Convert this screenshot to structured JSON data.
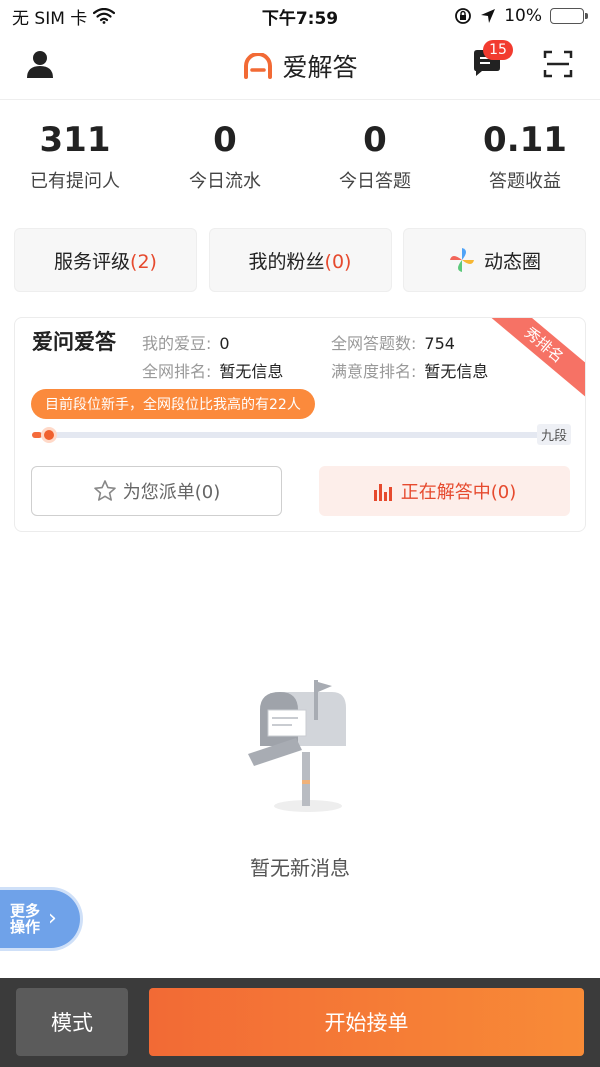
{
  "status_bar": {
    "carrier": "无 SIM 卡",
    "time": "下午7:59",
    "battery_percent": "10%",
    "battery_level": 0.1,
    "battery_color": "#e23b2b"
  },
  "header": {
    "title": "爱解答",
    "message_badge": "15",
    "accent": "#f26a35"
  },
  "stats": [
    {
      "value": "311",
      "label": "已有提问人"
    },
    {
      "value": "0",
      "label": "今日流水"
    },
    {
      "value": "0",
      "label": "今日答题"
    },
    {
      "value": "0.11",
      "label": "答题收益"
    }
  ],
  "quick_buttons": {
    "service_rating_label": "服务评级",
    "service_rating_count": "(2)",
    "fans_label": "我的粉丝",
    "fans_count": "(0)",
    "moments_label": "动态圈"
  },
  "rank_card": {
    "title": "爱问爱答",
    "beans_label": "我的爱豆:",
    "beans_value": "0",
    "total_answers_label": "全网答题数:",
    "total_answers_value": "754",
    "network_rank_label": "全网排名:",
    "network_rank_value": "暂无信息",
    "satisfaction_rank_label": "满意度排名:",
    "satisfaction_rank_value": "暂无信息",
    "ribbon": "秀排名",
    "tooltip": "目前段位新手，全网段位比我高的有22人",
    "level_end": "九段",
    "level_progress": 0.02,
    "assign_label": "为您派单(0)",
    "answering_label": "正在解答中(0)"
  },
  "empty_state": {
    "text": "暂无新消息"
  },
  "more_ops": {
    "line1": "更多",
    "line2": "操作"
  },
  "bottom_bar": {
    "mode_label": "模式",
    "start_label": "开始接单"
  }
}
